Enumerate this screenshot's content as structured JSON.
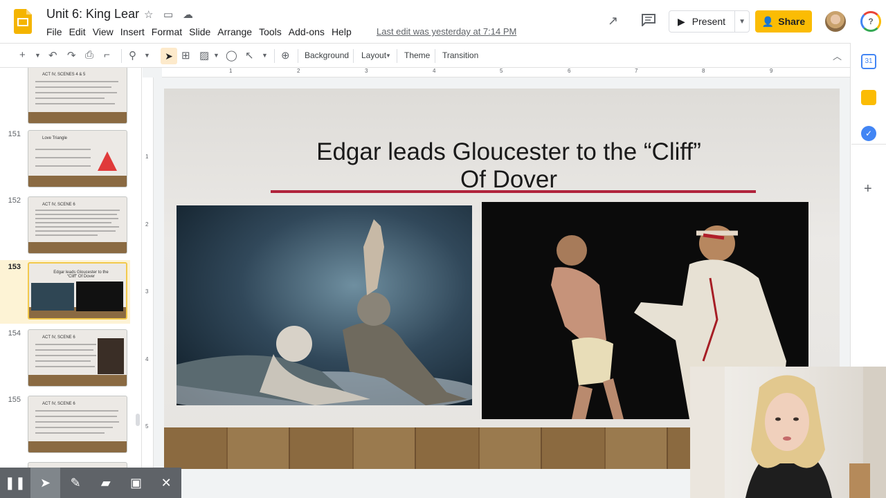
{
  "header": {
    "doc_title": "Unit 6: King Lear",
    "menu": [
      "File",
      "Edit",
      "View",
      "Insert",
      "Format",
      "Slide",
      "Arrange",
      "Tools",
      "Add-ons",
      "Help"
    ],
    "last_edit": "Last edit was yesterday at 7:14 PM",
    "present_label": "Present",
    "share_label": "Share"
  },
  "toolbar": {
    "background_label": "Background",
    "layout_label": "Layout",
    "theme_label": "Theme",
    "transition_label": "Transition"
  },
  "ruler": {
    "h_ticks": [
      "1",
      "2",
      "3",
      "4",
      "5",
      "6",
      "7",
      "8",
      "9"
    ],
    "v_ticks": [
      "1",
      "2",
      "3",
      "4",
      "5"
    ]
  },
  "filmstrip": {
    "slides": [
      {
        "num": "",
        "title": "ACT IV, SCENES 4 & 5"
      },
      {
        "num": "151",
        "title": "Love Triangle"
      },
      {
        "num": "152",
        "title": "ACT IV, SCENE 6"
      },
      {
        "num": "153",
        "title": "Edgar leads Gloucester to the “Cliff” Of Dover",
        "selected": true
      },
      {
        "num": "154",
        "title": "ACT IV, SCENE 6"
      },
      {
        "num": "155",
        "title": "ACT IV, SCENE 6"
      },
      {
        "num": "156",
        "title": ""
      }
    ]
  },
  "slide": {
    "title_line1": "Edgar leads Gloucester to the “Cliff”",
    "title_line2": "Of Dover",
    "accent_color": "#b0243c"
  },
  "recording_bar": {
    "icons": [
      "pause-icon",
      "pointer-icon",
      "pen-icon",
      "highlighter-icon",
      "camera-icon",
      "close-icon"
    ]
  }
}
